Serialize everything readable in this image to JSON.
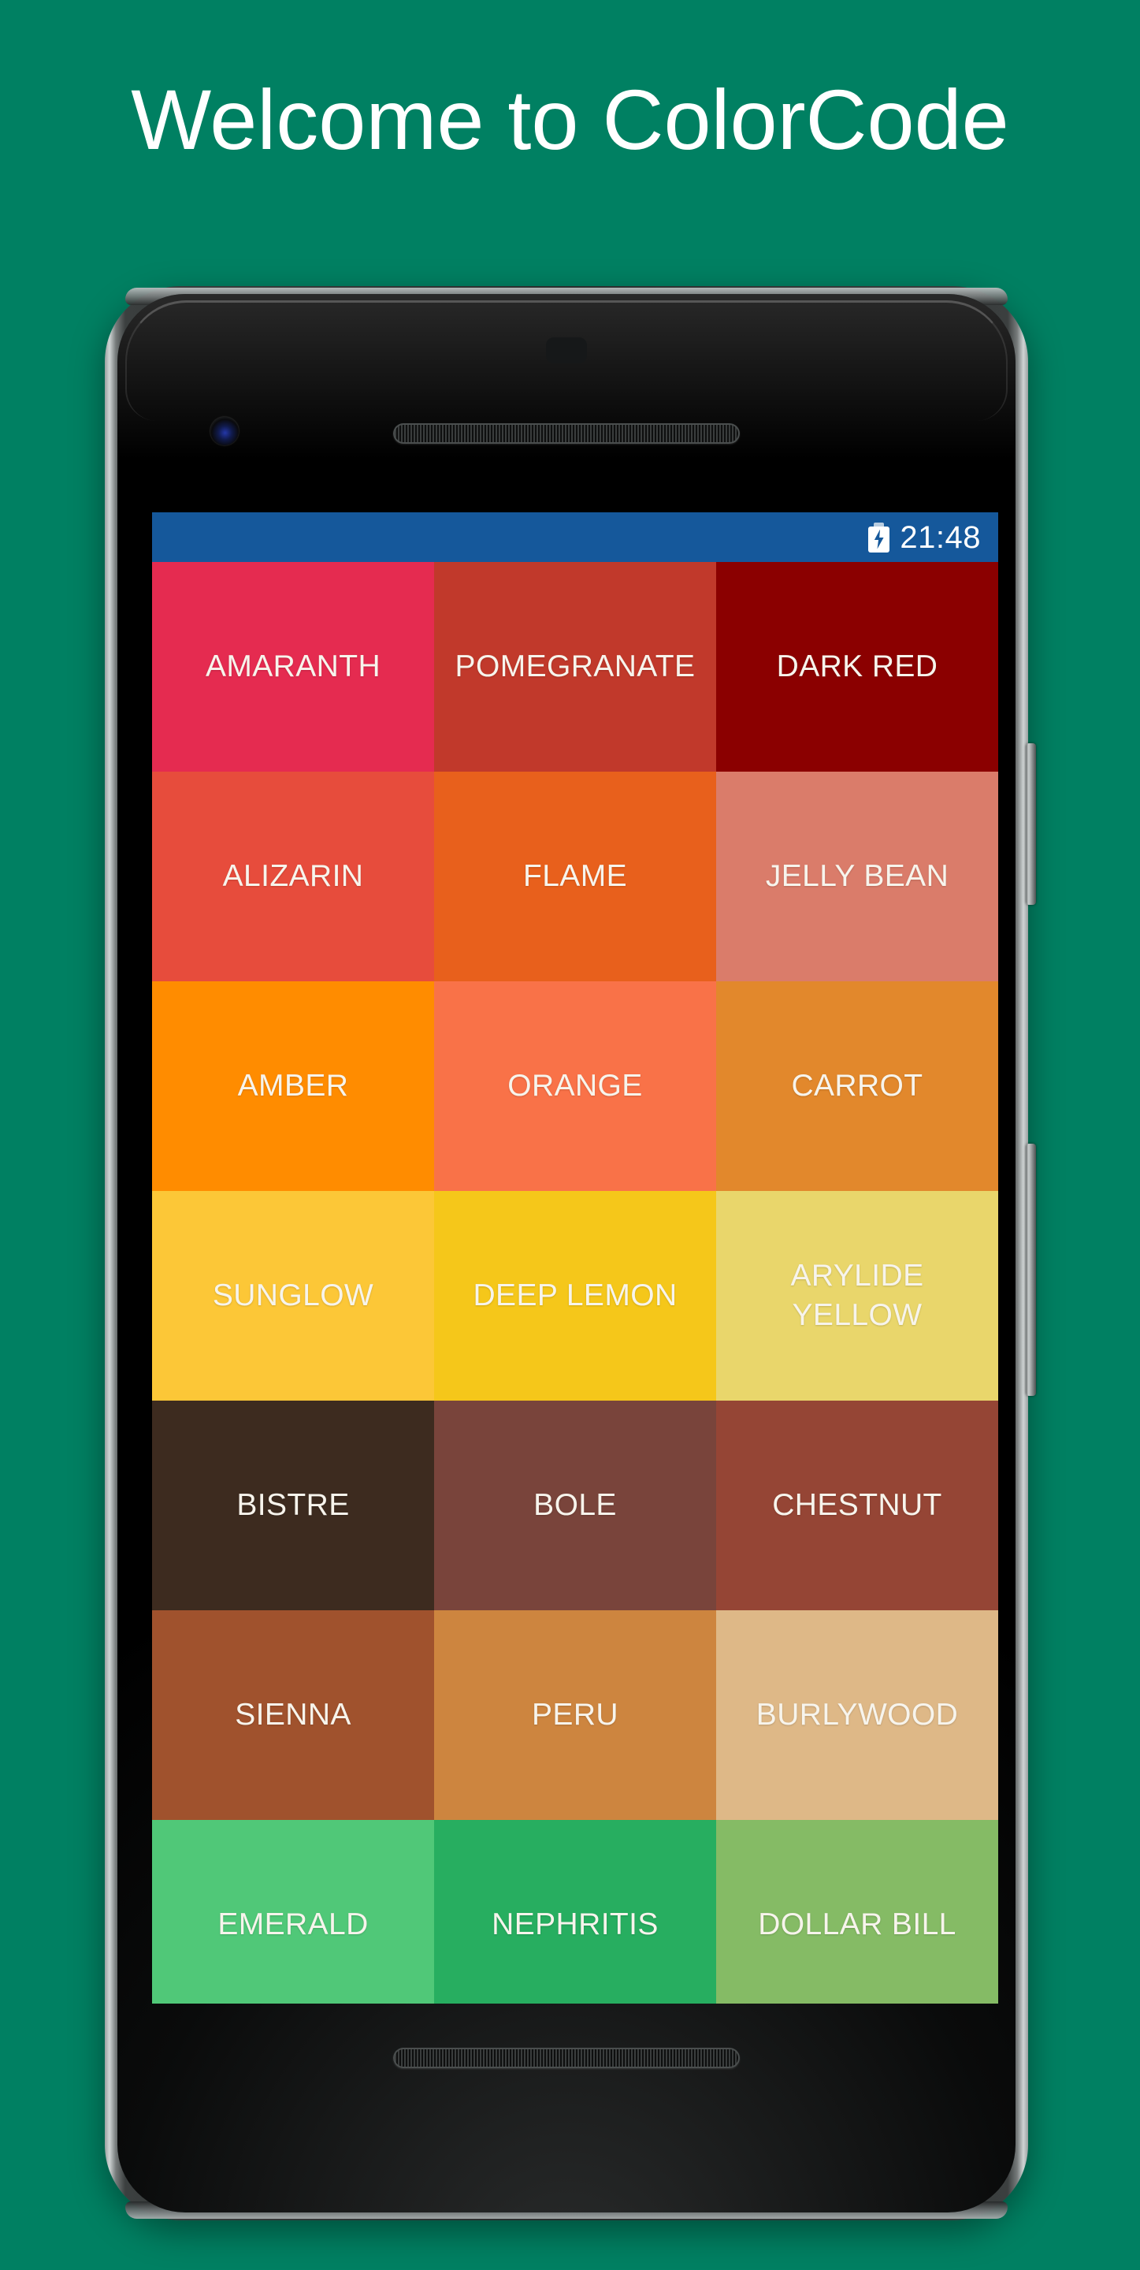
{
  "promo": {
    "background_color": "#008062",
    "headline": "Welcome to ColorCode"
  },
  "device": {
    "frame": "android-phone-mockup",
    "buttons": [
      "power-button",
      "volume-button"
    ],
    "sensors": [
      "front-camera",
      "proximity-sensor",
      "earpiece-speaker",
      "bottom-speaker"
    ]
  },
  "screen": {
    "statusbar": {
      "background_color": "#15589B",
      "battery_icon": "battery-charging-icon",
      "clock": "21:48"
    },
    "grid": {
      "columns": 3,
      "text_color": "#F7F4EC",
      "cells": [
        {
          "label": "AMARANTH",
          "color": "#E52B50"
        },
        {
          "label": "POMEGRANATE",
          "color": "#C1392B"
        },
        {
          "label": "DARK RED",
          "color": "#8B0000"
        },
        {
          "label": "ALIZARIN",
          "color": "#E74C3C"
        },
        {
          "label": "FLAME",
          "color": "#E8601C"
        },
        {
          "label": "JELLY BEAN",
          "color": "#DA7C6A"
        },
        {
          "label": "AMBER",
          "color": "#FF8C00"
        },
        {
          "label": "ORANGE",
          "color": "#F97248"
        },
        {
          "label": "CARROT",
          "color": "#E2882C"
        },
        {
          "label": "SUNGLOW",
          "color": "#FCC737"
        },
        {
          "label": "DEEP LEMON",
          "color": "#F5C71A"
        },
        {
          "label": "ARYLIDE YELLOW",
          "color": "#E9D66B"
        },
        {
          "label": "BISTRE",
          "color": "#3D2B1F"
        },
        {
          "label": "BOLE",
          "color": "#79443B"
        },
        {
          "label": "CHESTNUT",
          "color": "#954535"
        },
        {
          "label": "SIENNA",
          "color": "#A0522D"
        },
        {
          "label": "PERU",
          "color": "#CD853F"
        },
        {
          "label": "BURLYWOOD",
          "color": "#DEB887"
        },
        {
          "label": "EMERALD",
          "color": "#50C878"
        },
        {
          "label": "NEPHRITIS",
          "color": "#27AE60"
        },
        {
          "label": "DOLLAR BILL",
          "color": "#85BB65"
        }
      ]
    }
  }
}
